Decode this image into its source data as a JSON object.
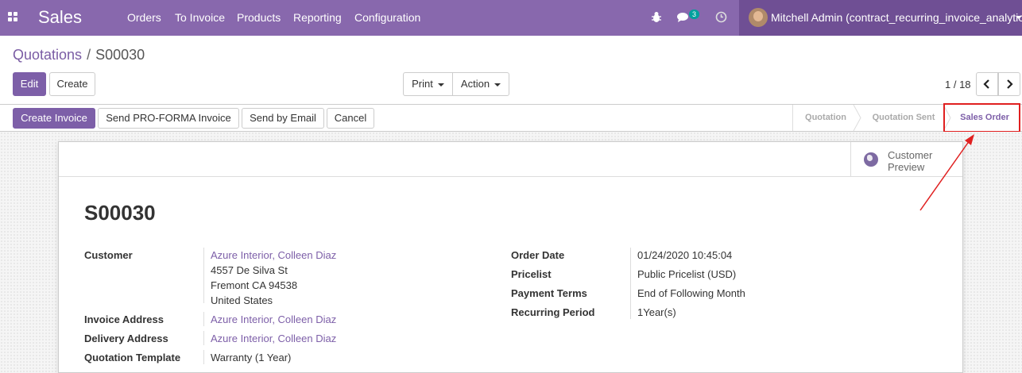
{
  "navbar": {
    "app_name": "Sales",
    "menu": [
      "Orders",
      "To Invoice",
      "Products",
      "Reporting",
      "Configuration"
    ],
    "messages_count": "3",
    "user_name": "Mitchell Admin (contract_recurring_invoice_analytic)",
    "colors": {
      "bar": "#8868ad",
      "user_area": "#6f4f94",
      "badge": "#00a09d"
    }
  },
  "breadcrumb": {
    "parent": "Quotations",
    "separator": "/",
    "current": "S00030"
  },
  "actions": {
    "edit": "Edit",
    "create": "Create",
    "print": "Print",
    "action": "Action"
  },
  "pager": {
    "value": "1 / 18"
  },
  "statusbar": {
    "buttons": [
      "Create Invoice",
      "Send PRO-FORMA Invoice",
      "Send by Email",
      "Cancel"
    ],
    "steps": [
      "Quotation",
      "Quotation Sent",
      "Sales Order"
    ],
    "active_step": "Sales Order"
  },
  "smart_button": {
    "label_line1": "Customer",
    "label_line2": "Preview",
    "icon": "globe-icon"
  },
  "record": {
    "name": "S00030",
    "left_fields": {
      "customer_label": "Customer",
      "customer_name": "Azure Interior, Colleen Diaz",
      "address_line1": "4557 De Silva St",
      "address_line2": "Fremont CA 94538",
      "address_line3": "United States",
      "invoice_address_label": "Invoice Address",
      "invoice_address": "Azure Interior, Colleen Diaz",
      "delivery_address_label": "Delivery Address",
      "delivery_address": "Azure Interior, Colleen Diaz",
      "template_label": "Quotation Template",
      "template": "Warranty (1 Year)"
    },
    "right_fields": {
      "order_date_label": "Order Date",
      "order_date": "01/24/2020 10:45:04",
      "pricelist_label": "Pricelist",
      "pricelist": "Public Pricelist (USD)",
      "payment_terms_label": "Payment Terms",
      "payment_terms": "End of Following Month",
      "recurring_period_label": "Recurring Period",
      "recurring_period": "1Year(s)"
    }
  }
}
